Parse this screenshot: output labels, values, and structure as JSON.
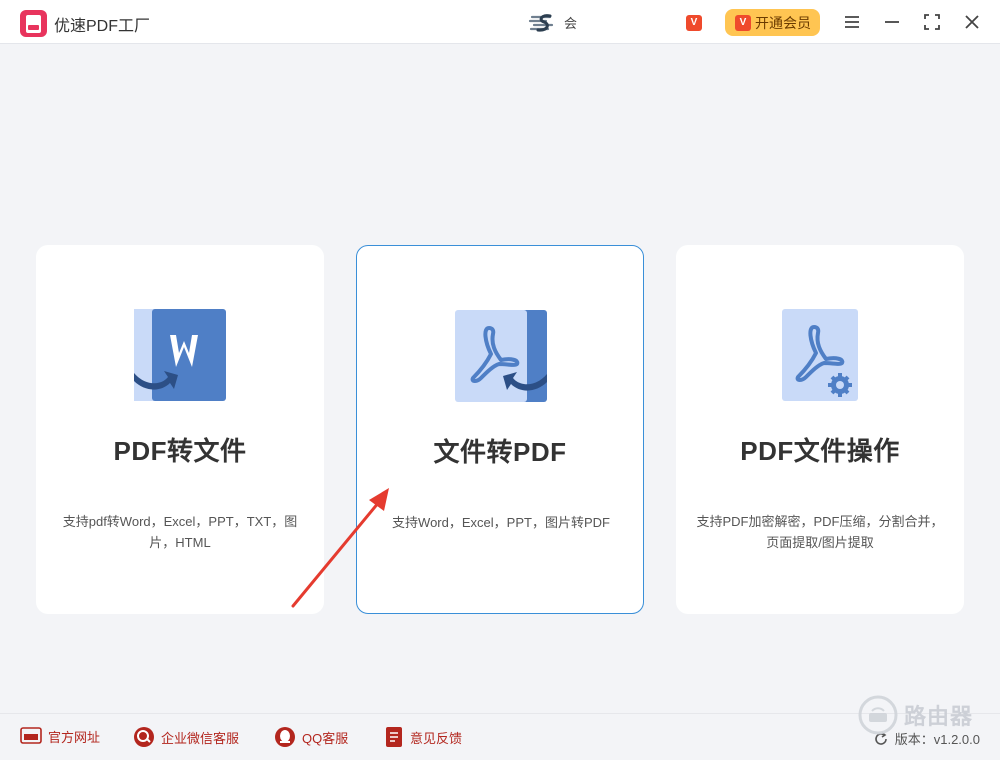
{
  "app": {
    "title": "优速PDF工厂"
  },
  "user": {
    "name": "会"
  },
  "header": {
    "vip_label": "开通会员",
    "vip_badge": "V"
  },
  "cards": [
    {
      "title": "PDF转文件",
      "desc": "支持pdf转Word，Excel，PPT，TXT，图片，HTML",
      "icon": "pdf-to-word-icon"
    },
    {
      "title": "文件转PDF",
      "desc": "支持Word，Excel，PPT，图片转PDF",
      "icon": "file-to-pdf-icon"
    },
    {
      "title": "PDF文件操作",
      "desc": "支持PDF加密解密，PDF压缩，分割合并，页面提取/图片提取",
      "icon": "pdf-operations-icon"
    }
  ],
  "footer": {
    "links": [
      "官方网址",
      "企业微信客服",
      "QQ客服",
      "意见反馈"
    ],
    "version_label": "版本：v1.2.0.0"
  },
  "watermark": {
    "text": "路由器"
  },
  "colors": {
    "accent": "#3a8fd8",
    "brand": "#e8345d",
    "vip": "#ffc552",
    "link": "#b3261e",
    "icon_blue": "#4f7fc6",
    "icon_light": "#c9daf8"
  }
}
